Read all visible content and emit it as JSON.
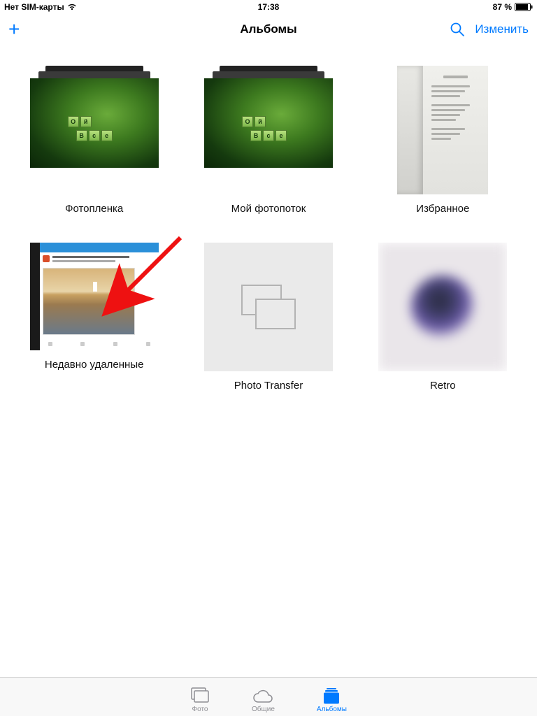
{
  "status_bar": {
    "sim_text": "Нет SIM-карты",
    "time": "17:38",
    "battery_text": "87 %"
  },
  "nav": {
    "title": "Альбомы",
    "edit_label": "Изменить"
  },
  "albums": [
    {
      "id": "camera-roll",
      "label": "Фотопленка"
    },
    {
      "id": "my-photostream",
      "label": "Мой фотопоток"
    },
    {
      "id": "favorites",
      "label": "Избранное"
    },
    {
      "id": "recently-deleted",
      "label": "Недавно удаленные"
    },
    {
      "id": "photo-transfer",
      "label": "Photo Transfer"
    },
    {
      "id": "retro",
      "label": "Retro"
    }
  ],
  "tabs": {
    "photos": "Фото",
    "shared": "Общие",
    "albums": "Альбомы"
  },
  "colors": {
    "accent": "#007aff",
    "inactive": "#8e8e93"
  }
}
